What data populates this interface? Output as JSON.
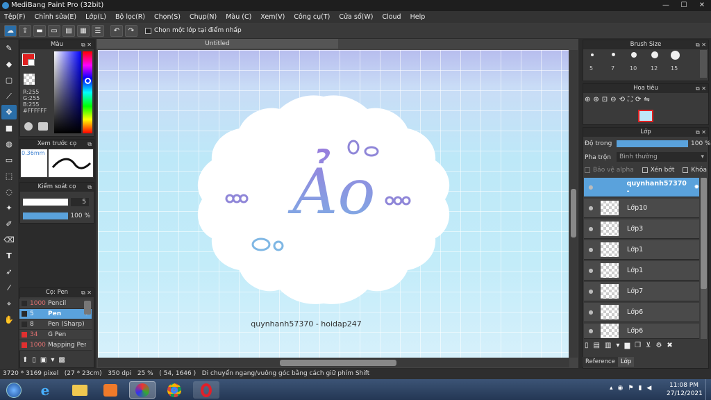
{
  "window": {
    "title": "MediBang Paint Pro (32bit)"
  },
  "menu": [
    "Tệp(F)",
    "Chỉnh sửa(E)",
    "Lớp(L)",
    "Bộ lọc(R)",
    "Chọn(S)",
    "Chụp(N)",
    "Màu (C)",
    "Xem(V)",
    "Công cụ(T)",
    "Cửa sổ(W)",
    "Cloud",
    "Help"
  ],
  "toolbar": {
    "checkbox_label": "Chọn một lớp tại điểm nhấp"
  },
  "color_panel": {
    "title": "Màu",
    "r": "R:255",
    "g": "G:255",
    "b": "B:255",
    "hex": "#FFFFFF"
  },
  "brush_preview": {
    "title": "Xem trước cọ",
    "size": "0.36mm"
  },
  "brush_control": {
    "title": "Kiểm soát cọ",
    "size": "5",
    "opacity": "100 %"
  },
  "brush_list": {
    "title": "Cọ: Pen",
    "items": [
      {
        "num": "1000",
        "name": "Pencil",
        "color": "#2a2a2a"
      },
      {
        "num": "5",
        "name": "Pen",
        "color": "#2a2a2a"
      },
      {
        "num": "8",
        "name": "Pen (Sharp)",
        "color": "#2a2a2a"
      },
      {
        "num": "34",
        "name": "G Pen",
        "color": "#e03030"
      },
      {
        "num": "1000",
        "name": "Mapping Pen",
        "color": "#e03030"
      }
    ]
  },
  "document": {
    "tab": "Untitled",
    "title_text": "Ảo",
    "watermark": "quynhanh57370 - hoidap247"
  },
  "brush_size": {
    "title": "Brush Size",
    "sizes": [
      "5",
      "7",
      "10",
      "12",
      "15"
    ]
  },
  "navigator": {
    "title": "Hoa tiêu"
  },
  "layers": {
    "title": "Lớp",
    "opacity_label": "Độ trong",
    "opacity_value": "100 %",
    "blend_label": "Pha trộn",
    "blend_value": "Bình thường",
    "protect_alpha": "Bảo vệ alpha",
    "clipping": "Xén bớt",
    "lock": "Khóa",
    "items": [
      "quynhanh57370 -",
      "Lớp10",
      "Lớp3",
      "Lớp1",
      "Lớp1",
      "Lớp7",
      "Lớp6",
      "Lớp6"
    ],
    "tabs": [
      "Reference",
      "Lớp"
    ]
  },
  "status": {
    "size": "3720 * 3169 pixel",
    "physical": "(27 * 23cm)",
    "dpi": "350 dpi",
    "zoom": "25 %",
    "coords": "( 54, 1646 )",
    "hint": "Di chuyển ngang/vuông góc bằng cách giữ phím Shift"
  },
  "taskbar": {
    "time": "11:08 PM",
    "date": "27/12/2021"
  }
}
